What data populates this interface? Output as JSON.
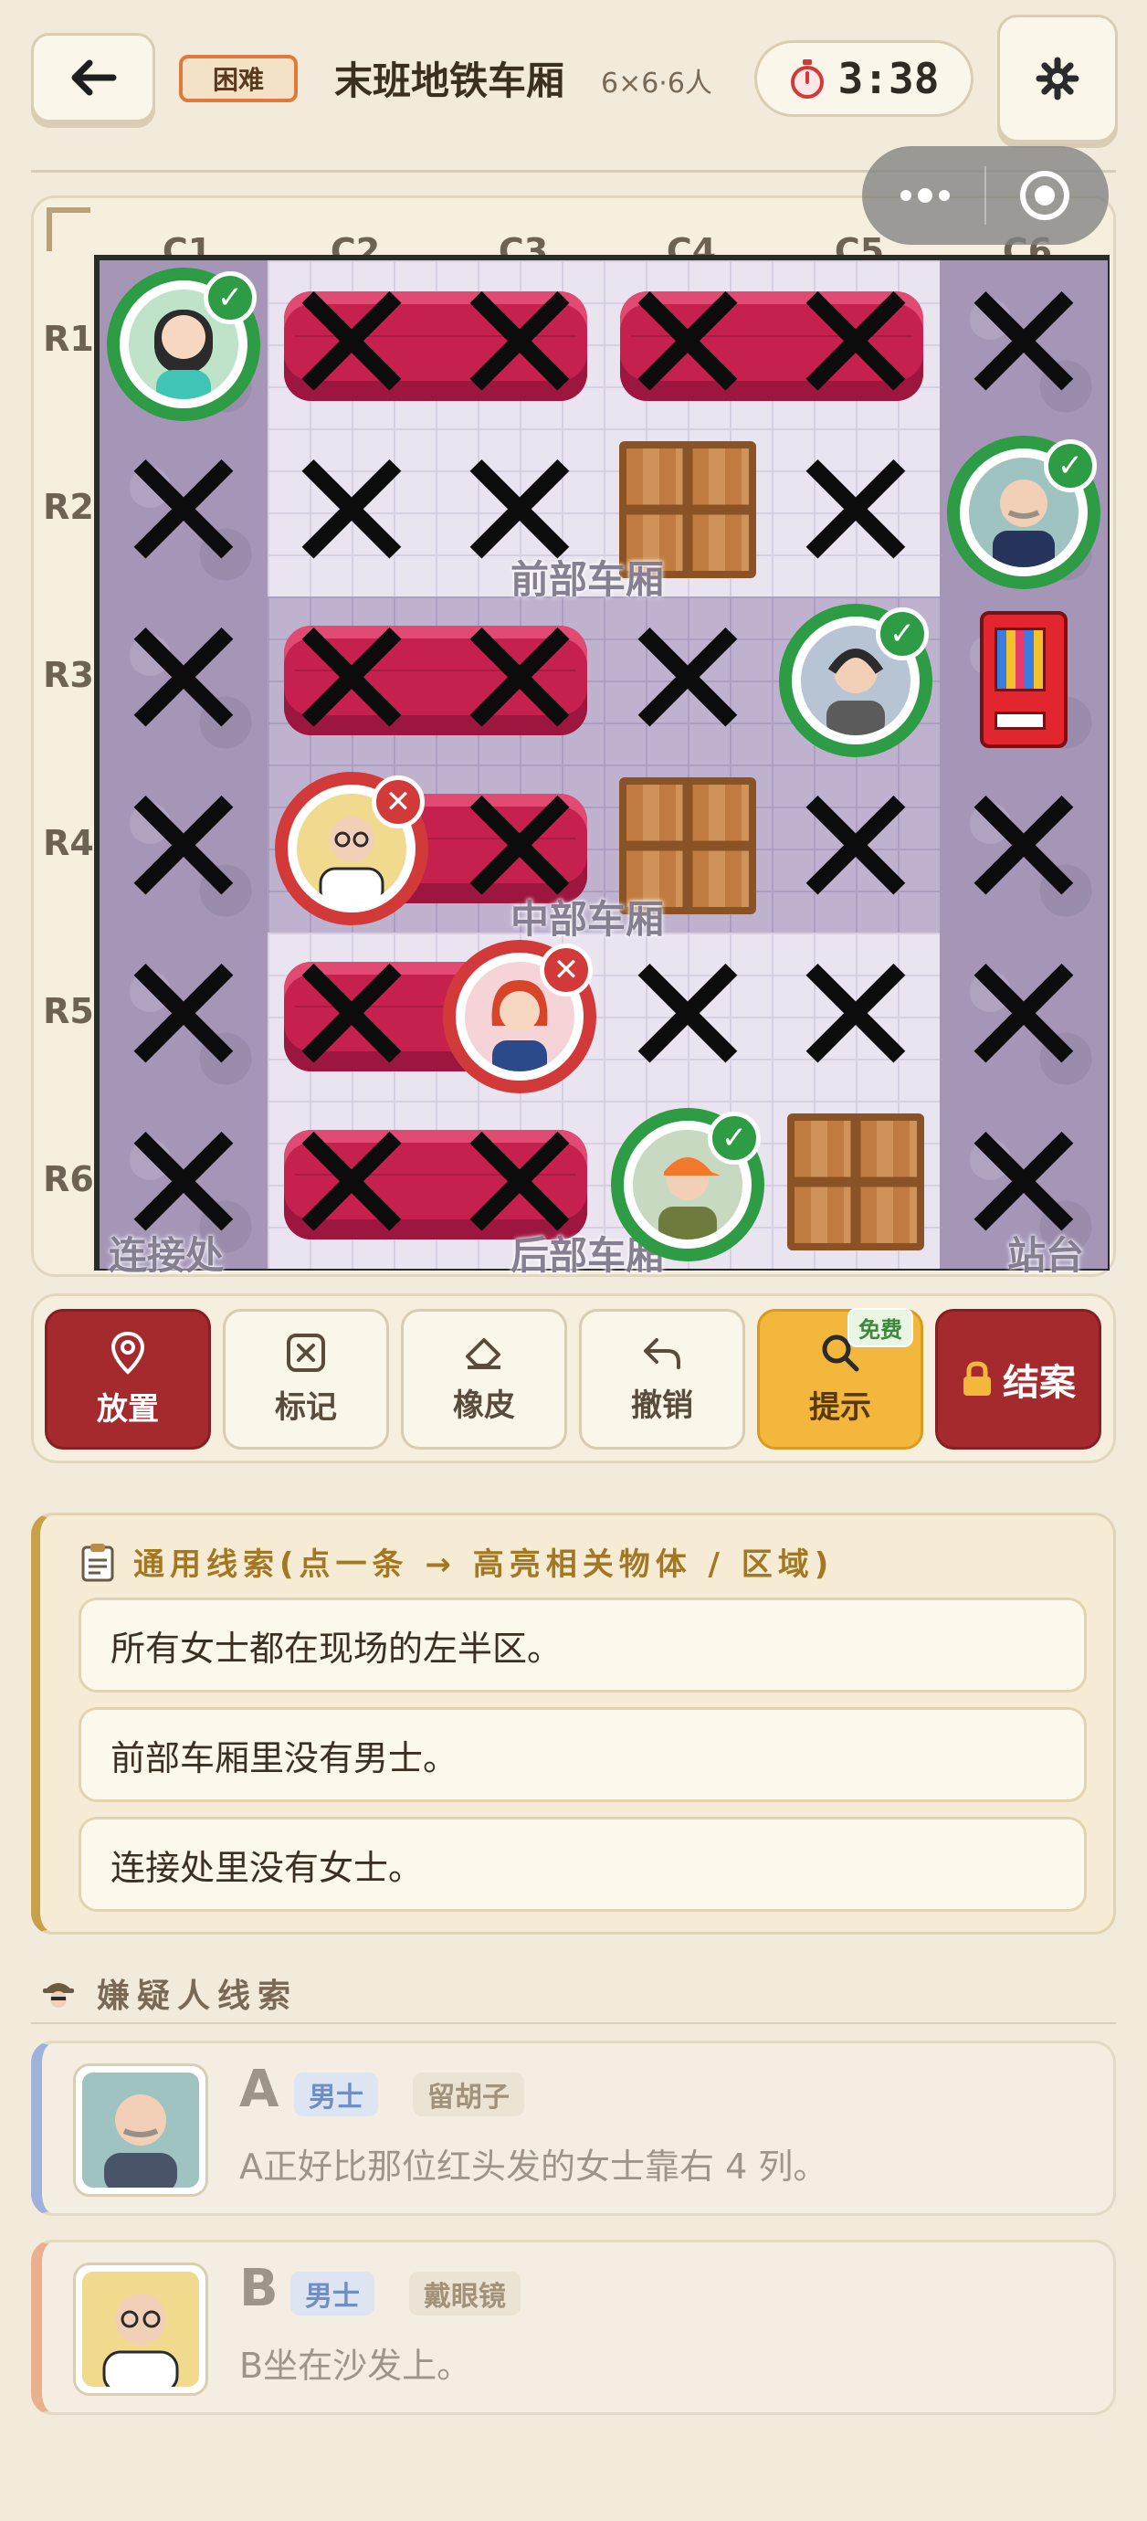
{
  "header": {
    "difficulty": "困难",
    "title": "末班地铁车厢",
    "size": "6×6·6人",
    "timer": "3:38"
  },
  "board": {
    "columns": [
      "C1",
      "C2",
      "C3",
      "C4",
      "C5",
      "C6"
    ],
    "rows": [
      "R1",
      "R2",
      "R3",
      "R4",
      "R5",
      "R6"
    ],
    "zones": {
      "front": "前部车厢",
      "middle": "中部车厢",
      "rear": "后部车厢",
      "connector": "连接处",
      "platform": "站台"
    }
  },
  "toolbar": {
    "place": "放置",
    "mark": "标记",
    "eraser": "橡皮",
    "undo": "撤销",
    "hint": "提示",
    "hint_badge": "免费",
    "close_case": "结案"
  },
  "general_clues": {
    "title": "通用线索(点一条 → 高亮相关物体 / 区域)",
    "items": [
      "所有女士都在现场的左半区。",
      "前部车厢里没有男士。",
      "连接处里没有女士。"
    ]
  },
  "suspects": {
    "title": "嫌疑人线索",
    "items": [
      {
        "letter": "A",
        "gender": "男士",
        "trait": "留胡子",
        "clue": "A正好比那位红头发的女士靠右 4 列。"
      },
      {
        "letter": "B",
        "gender": "男士",
        "trait": "戴眼镜",
        "clue": "B坐在沙发上。"
      }
    ]
  },
  "colors": {
    "correct": "#2d9c45",
    "wrong": "#d23a3a",
    "primary_button": "#a52a2e",
    "hint_button": "#f3b73b"
  }
}
